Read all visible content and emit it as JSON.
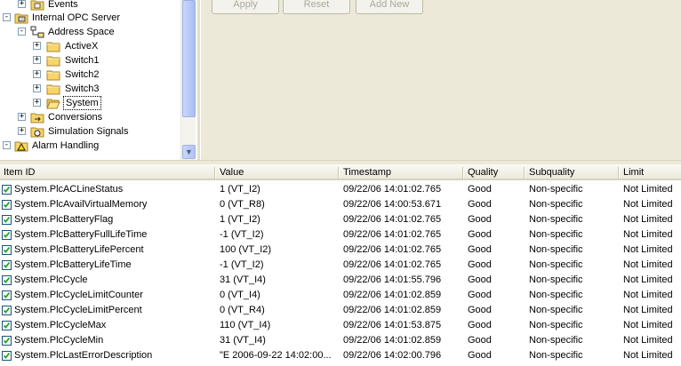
{
  "tree": {
    "nodes": [
      {
        "label": "Events",
        "icon": "events-folder-icon",
        "expander": "+"
      },
      {
        "label": "Internal OPC Server",
        "icon": "server-icon",
        "expander": "-"
      },
      {
        "label": "Address Space",
        "icon": "address-space-icon",
        "expander": "-"
      },
      {
        "label": "ActiveX",
        "icon": "folder-icon",
        "expander": "+"
      },
      {
        "label": "Switch1",
        "icon": "folder-icon",
        "expander": "+"
      },
      {
        "label": "Switch2",
        "icon": "folder-icon",
        "expander": "+"
      },
      {
        "label": "Switch3",
        "icon": "folder-icon",
        "expander": "+"
      },
      {
        "label": "System",
        "icon": "open-folder-icon",
        "expander": "+",
        "selected": true
      },
      {
        "label": "Conversions",
        "icon": "conversions-icon",
        "expander": "+"
      },
      {
        "label": "Simulation Signals",
        "icon": "simulation-icon",
        "expander": "+"
      },
      {
        "label": "Alarm Handling",
        "icon": "alarm-icon",
        "expander": "-"
      }
    ]
  },
  "toolbar": {
    "apply_label": "Apply",
    "reset_label": "Reset",
    "add_new_label": "Add New"
  },
  "table": {
    "headers": [
      "Item ID",
      "Value",
      "Timestamp",
      "Quality",
      "Subquality",
      "Limit"
    ],
    "rows": [
      {
        "item": "System.PlcACLineStatus",
        "value": "1 (VT_I2)",
        "timestamp": "09/22/06 14:01:02.765",
        "quality": "Good",
        "subquality": "Non-specific",
        "limit": "Not Limited"
      },
      {
        "item": "System.PlcAvailVirtualMemory",
        "value": "0 (VT_R8)",
        "timestamp": "09/22/06 14:00:53.671",
        "quality": "Good",
        "subquality": "Non-specific",
        "limit": "Not Limited"
      },
      {
        "item": "System.PlcBatteryFlag",
        "value": "1 (VT_I2)",
        "timestamp": "09/22/06 14:01:02.765",
        "quality": "Good",
        "subquality": "Non-specific",
        "limit": "Not Limited"
      },
      {
        "item": "System.PlcBatteryFullLifeTime",
        "value": "-1 (VT_I2)",
        "timestamp": "09/22/06 14:01:02.765",
        "quality": "Good",
        "subquality": "Non-specific",
        "limit": "Not Limited"
      },
      {
        "item": "System.PlcBatteryLifePercent",
        "value": "100 (VT_I2)",
        "timestamp": "09/22/06 14:01:02.765",
        "quality": "Good",
        "subquality": "Non-specific",
        "limit": "Not Limited"
      },
      {
        "item": "System.PlcBatteryLifeTime",
        "value": "-1 (VT_I2)",
        "timestamp": "09/22/06 14:01:02.765",
        "quality": "Good",
        "subquality": "Non-specific",
        "limit": "Not Limited"
      },
      {
        "item": "System.PlcCycle",
        "value": "31 (VT_I4)",
        "timestamp": "09/22/06 14:01:55.796",
        "quality": "Good",
        "subquality": "Non-specific",
        "limit": "Not Limited"
      },
      {
        "item": "System.PlcCycleLimitCounter",
        "value": "0 (VT_I4)",
        "timestamp": "09/22/06 14:01:02.859",
        "quality": "Good",
        "subquality": "Non-specific",
        "limit": "Not Limited"
      },
      {
        "item": "System.PlcCycleLimitPercent",
        "value": "0 (VT_R4)",
        "timestamp": "09/22/06 14:01:02.859",
        "quality": "Good",
        "subquality": "Non-specific",
        "limit": "Not Limited"
      },
      {
        "item": "System.PlcCycleMax",
        "value": "110 (VT_I4)",
        "timestamp": "09/22/06 14:01:53.875",
        "quality": "Good",
        "subquality": "Non-specific",
        "limit": "Not Limited"
      },
      {
        "item": "System.PlcCycleMin",
        "value": "31 (VT_I4)",
        "timestamp": "09/22/06 14:01:02.859",
        "quality": "Good",
        "subquality": "Non-specific",
        "limit": "Not Limited"
      },
      {
        "item": "System.PlcLastErrorDescription",
        "value": "\"E 2006-09-22 14:02:00...",
        "timestamp": "09/22/06 14:02:00.796",
        "quality": "Good",
        "subquality": "Non-specific",
        "limit": "Not Limited"
      }
    ]
  },
  "colors": {
    "panel": "#ece9d8",
    "checkbox_border": "#1c5180",
    "check_mark": "#21a121"
  }
}
